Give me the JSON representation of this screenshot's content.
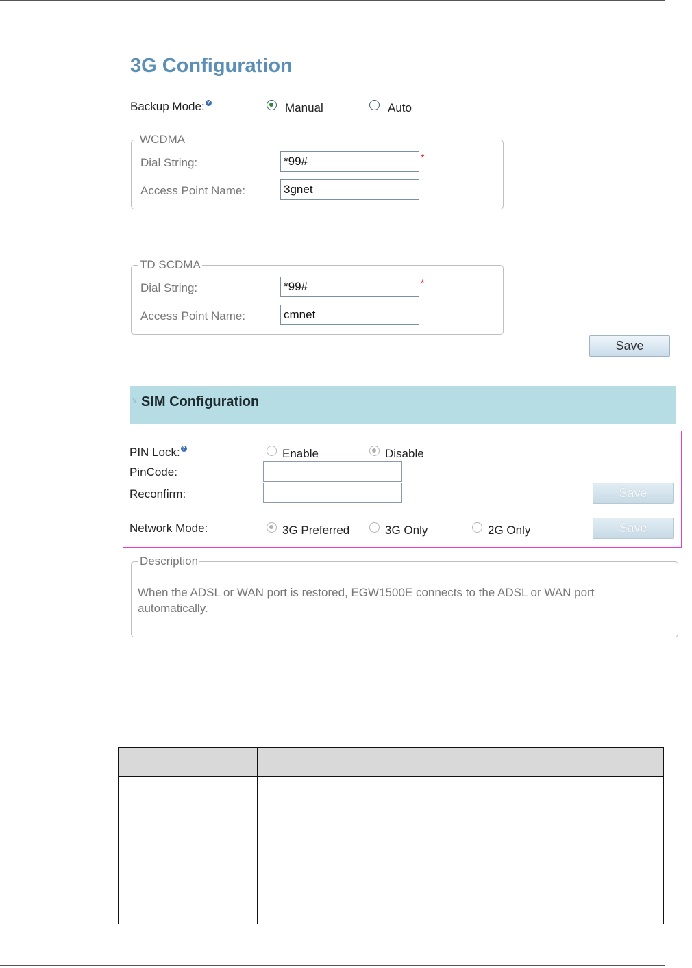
{
  "page": {
    "title": "3G Configuration",
    "backup_mode": {
      "label": "Backup Mode:",
      "help_glyph": "?",
      "options": [
        {
          "label": "Manual",
          "selected": true
        },
        {
          "label": "Auto",
          "selected": false
        }
      ]
    },
    "wcdma": {
      "legend": "WCDMA",
      "dial_label": "Dial String:",
      "dial_value": "*99#",
      "required_mark": "*",
      "apn_label": "Access Point Name:",
      "apn_value": "3gnet"
    },
    "tdscdma": {
      "legend": "TD SCDMA",
      "dial_label": "Dial String:",
      "dial_value": "*99#",
      "required_mark": "*",
      "apn_label": "Access Point Name:",
      "apn_value": "cmnet"
    },
    "save_label": "Save"
  },
  "sim": {
    "title": "SIM Configuration",
    "chevron_glyph": "∨",
    "pin_lock": {
      "label": "PIN Lock:",
      "help_glyph": "?",
      "options": [
        {
          "label": "Enable",
          "selected": false
        },
        {
          "label": "Disable",
          "selected": true
        }
      ]
    },
    "pincode_label": "PinCode:",
    "pincode_value": "",
    "reconfirm_label": "Reconfirm:",
    "reconfirm_value": "",
    "save_label": "Save",
    "network_mode": {
      "label": "Network Mode:",
      "options": [
        {
          "label": "3G Preferred",
          "selected": true
        },
        {
          "label": "3G Only",
          "selected": false
        },
        {
          "label": "2G Only",
          "selected": false
        }
      ]
    },
    "network_save_label": "Save",
    "highlight_color": "#e83cd7",
    "bar_color": "#b5dde3"
  },
  "description": {
    "legend": "Description",
    "text": "When the ADSL or WAN port is restored, EGW1500E connects to the ADSL or WAN port automatically."
  },
  "table": {
    "headers": [
      "",
      ""
    ],
    "rows": [
      [
        "",
        ""
      ]
    ]
  },
  "colors": {
    "title": "#5b8fb5",
    "required": "#d22222"
  },
  "icons": {
    "help": "help-icon",
    "radio_selected": "radio-selected-icon",
    "radio_unselected": "radio-unselected-icon",
    "collapse": "chevron-down-icon"
  }
}
